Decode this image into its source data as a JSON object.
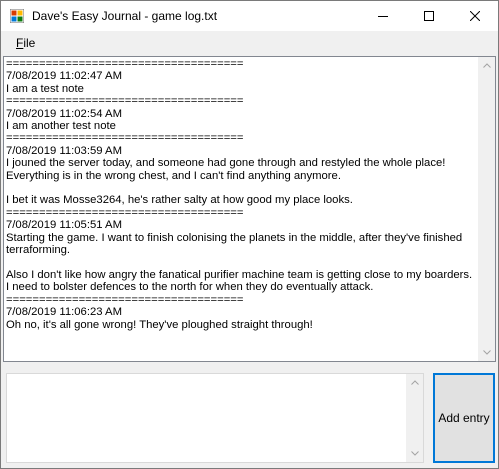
{
  "window": {
    "title": "Dave's Easy Journal - game log.txt"
  },
  "menu": {
    "file_mnemonic": "F",
    "file_rest": "ile"
  },
  "journal": {
    "text": "====================================\n7/08/2019 11:02:47 AM\nI am a test note\n====================================\n7/08/2019 11:02:54 AM\nI am another test note\n====================================\n7/08/2019 11:03:59 AM\nI jouned the server today, and someone had gone through and restyled the whole place! Everything is in the wrong chest, and I can't find anything anymore.\n\nI bet it was Mosse3264, he's rather salty at how good my place looks.\n====================================\n7/08/2019 11:05:51 AM\nStarting the game. I want to finish colonising the planets in the middle, after they've finished terraforming.\n\nAlso I don't like how angry the fanatical purifier machine team is getting close to my boarders. I need to bolster defences to the north for when they do eventually attack.\n====================================\n7/08/2019 11:06:23 AM\nOh no, it's all gone wrong! They've ploughed straight through!"
  },
  "entry": {
    "value": "",
    "button_label": "Add entry"
  },
  "icons": {
    "app": "journal-app-icon",
    "minimize": "minimize-icon",
    "maximize": "maximize-icon",
    "close": "close-icon",
    "scroll_up": "chevron-up-icon",
    "scroll_down": "chevron-down-icon"
  },
  "colors": {
    "accent": "#0078d7",
    "window_bg": "#f0f0f0",
    "button_bg": "#e1e1e1"
  }
}
